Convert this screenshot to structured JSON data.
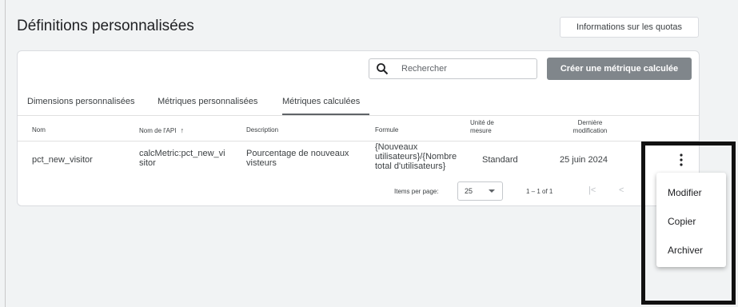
{
  "page": {
    "title": "Définitions personnalisées",
    "quota_button": "Informations sur les quotas"
  },
  "toolbar": {
    "search_placeholder": "Rechercher",
    "create_button": "Créer une métrique calculée"
  },
  "tabs": [
    {
      "label": "Dimensions personnalisées",
      "active": false
    },
    {
      "label": "Métriques personnalisées",
      "active": false
    },
    {
      "label": "Métriques calculées",
      "active": true
    }
  ],
  "table": {
    "headers": {
      "name": "Nom",
      "api_name": "Nom de l'API",
      "description": "Description",
      "formula": "Formule",
      "unit": "Unité de\nmesure",
      "last_modified": "Dernière\nmodification"
    },
    "rows": [
      {
        "name": "pct_new_visitor",
        "api_name": "calcMetric:pct_new_vi\nsitor",
        "description": "Pourcentage de nouveaux\nvisteurs",
        "formula": "{Nouveaux\nutilisateurs}/{Nombre\ntotal d'utilisateurs}",
        "unit": "Standard",
        "last_modified": "25 juin 2024"
      }
    ]
  },
  "pager": {
    "items_label": "Items per page:",
    "items_value": "25",
    "range": "1 – 1 of 1",
    "first_icon": "first-page-icon",
    "prev_icon": "chevron-left-icon"
  },
  "context_menu": {
    "items": [
      "Modifier",
      "Copier",
      "Archiver"
    ]
  },
  "colors": {
    "create_button_bg": "#80868b",
    "highlight_border": "#111111"
  }
}
